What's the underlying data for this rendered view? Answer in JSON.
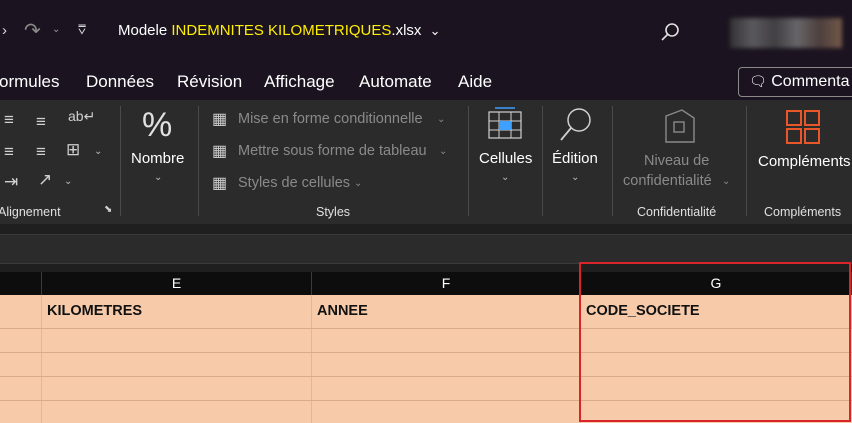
{
  "titlebar": {
    "filename_prefix": "Modele ",
    "filename_highlight": "INDEMNITES KILOMETRIQUES",
    "filename_ext": ".xlsx",
    "filename_chevron": "⌄"
  },
  "tabs": [
    "ormules",
    "Données",
    "Révision",
    "Affichage",
    "Automate",
    "Aide"
  ],
  "comment_button": "Commenta",
  "ribbon": {
    "alignment_label": "Alignement",
    "number": {
      "label": "Nombre"
    },
    "styles": {
      "conditional": "Mise en forme conditionnelle",
      "table": "Mettre sous forme de tableau",
      "cell_styles": "Styles de cellules",
      "label": "Styles"
    },
    "cells": {
      "label": "Cellules"
    },
    "editing": {
      "label": "Édition"
    },
    "sensitivity": {
      "line1": "Niveau de",
      "line2": "confidentialité",
      "group": "Confidentialité"
    },
    "addins": {
      "label": "Compléments",
      "group": "Compléments"
    }
  },
  "columns": {
    "e": "E",
    "f": "F",
    "g": "G"
  },
  "row1": {
    "e": "KILOMETRES",
    "f": "ANNEE",
    "g": "CODE_SOCIETE"
  },
  "colors": {
    "row_fill": "#f7cbaa",
    "selection": "#d9252a",
    "highlight": "#ffef00"
  }
}
